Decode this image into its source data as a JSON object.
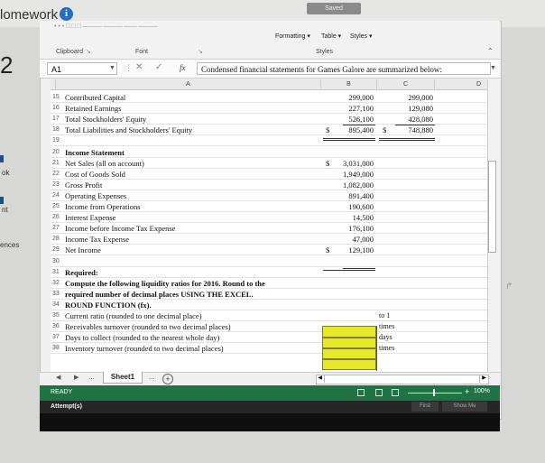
{
  "page": {
    "title": "lomework",
    "question_number": "2",
    "saved_label": "Saved",
    "side_labels": [
      "ok",
      "nt",
      "ences"
    ]
  },
  "ribbon": {
    "top_labels": "• • •  □ □ □   ——— ———   —— ———",
    "formatting_label": "Formatting",
    "table_label": "Table",
    "styles_label": "Styles",
    "clipboard_label": "Clipboard",
    "font_label": "Font",
    "styles_group_label": "Styles"
  },
  "formula_bar": {
    "name_box": "A1",
    "fx_label": "fx",
    "cancel_label": "✕",
    "enter_label": "✓",
    "content": "Condensed financial statements for Games Galore are summarized below:"
  },
  "columns": [
    "A",
    "B",
    "C",
    "D"
  ],
  "rows": [
    {
      "n": "15",
      "a": "Contributed Capital",
      "b": "299,000",
      "c": "299,000"
    },
    {
      "n": "16",
      "a": "Retained Earnings",
      "b": "227,100",
      "c": "129,080"
    },
    {
      "n": "17",
      "a": "   Total Stockholders' Equity",
      "b": "526,100",
      "c": "428,080"
    },
    {
      "n": "18",
      "a": "   Total Liabilities and Stockholders' Equity",
      "bs": "$",
      "b": "895,400",
      "cs": "$",
      "c": "748,880"
    },
    {
      "n": "19",
      "a": "",
      "b": "",
      "c": ""
    },
    {
      "n": "20",
      "a": "Income Statement",
      "b": "",
      "c": ""
    },
    {
      "n": "21",
      "a": "Net Sales (all on account)",
      "bs": "$",
      "b": "3,031,000",
      "c": ""
    },
    {
      "n": "22",
      "a": "Cost of Goods Sold",
      "b": "1,949,000",
      "c": ""
    },
    {
      "n": "23",
      "a": "Gross Profit",
      "b": "1,082,000",
      "c": ""
    },
    {
      "n": "24",
      "a": "Operating Expenses",
      "b": "891,400",
      "c": ""
    },
    {
      "n": "25",
      "a": "Income from Operations",
      "b": "190,600",
      "c": ""
    },
    {
      "n": "26",
      "a": "Interest Expense",
      "b": "14,500",
      "c": ""
    },
    {
      "n": "27",
      "a": "Income before Income Tax Expense",
      "b": "176,100",
      "c": ""
    },
    {
      "n": "28",
      "a": "Income Tax Expense",
      "b": "47,000",
      "c": ""
    },
    {
      "n": "29",
      "a": "Net Income",
      "bs": "$",
      "b": "129,100",
      "c": ""
    },
    {
      "n": "30",
      "a": "",
      "b": "",
      "c": ""
    },
    {
      "n": "31",
      "a": "Required:",
      "b": "",
      "c": ""
    },
    {
      "n": "32",
      "a": "Compute the following liquidity ratios for 2016. Round to the",
      "b": "",
      "c": ""
    },
    {
      "n": "33",
      "a": "required number of decimal places USING THE EXCEL.",
      "b": "",
      "c": ""
    },
    {
      "n": "34",
      "a": "ROUND FUNCTION (fx).",
      "b": "",
      "c": ""
    },
    {
      "n": "35",
      "a": "   Current ratio (rounded to one decimal place)",
      "b": "",
      "c": "to 1"
    },
    {
      "n": "36",
      "a": "   Receivables turnover (rounded to two decimal places)",
      "b": "",
      "c": "times"
    },
    {
      "n": "37",
      "a": "   Days to collect (rounded to the nearest whole day)",
      "b": "",
      "c": "days"
    },
    {
      "n": "38",
      "a": "   Inventory turnover (rounded to two decimal places)",
      "b": "",
      "c": "times"
    }
  ],
  "sheet": {
    "tab_label": "Sheet1",
    "ellipsis": "...",
    "plus": "+"
  },
  "status": {
    "ready": "READY",
    "zoom": "100%",
    "attempts": "Attempt(s)",
    "first_btn": "First",
    "show_me_btn": "Show Me"
  }
}
